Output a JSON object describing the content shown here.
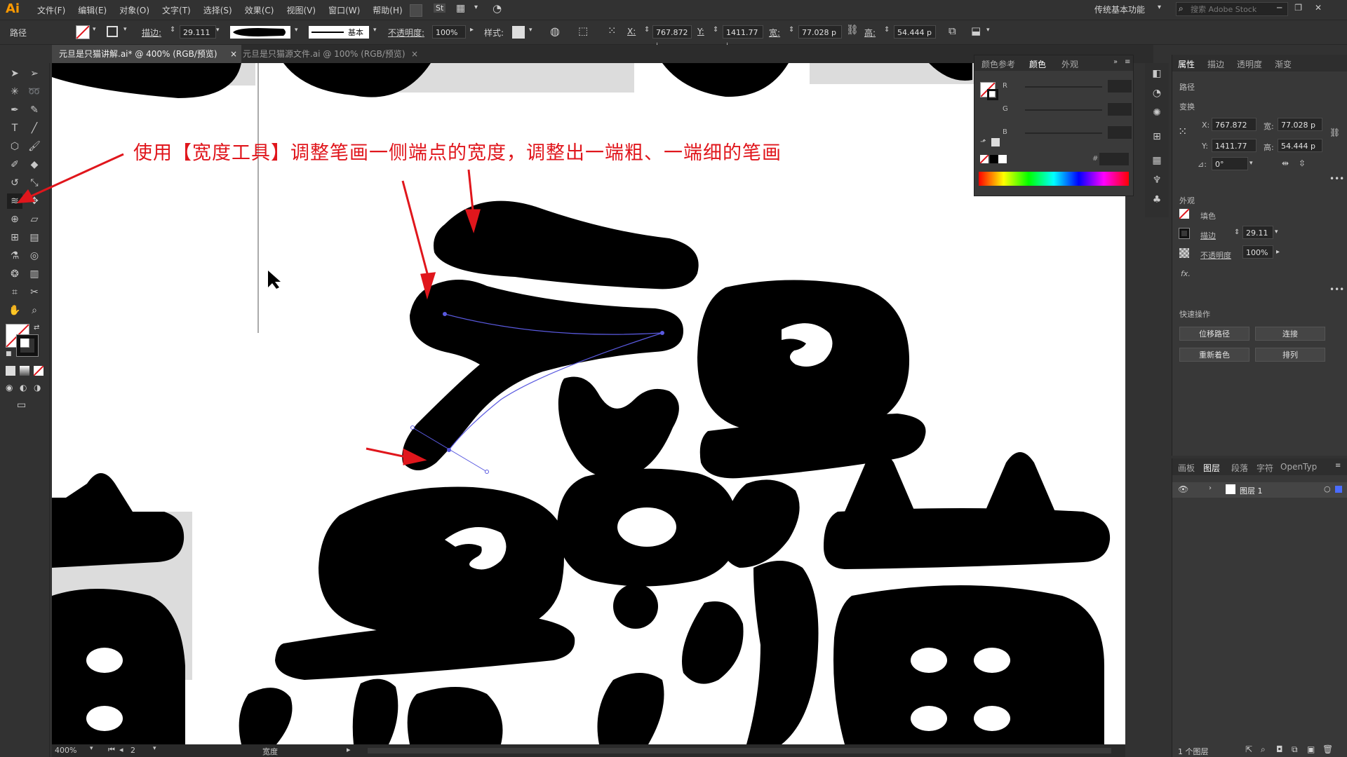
{
  "app": {
    "logo": "Ai",
    "workspace": "传统基本功能",
    "stock_search_placeholder": "搜索 Adobe Stock"
  },
  "menu": [
    "文件(F)",
    "编辑(E)",
    "对象(O)",
    "文字(T)",
    "选择(S)",
    "效果(C)",
    "视图(V)",
    "窗口(W)",
    "帮助(H)"
  ],
  "menu_extra": {
    "st": "St"
  },
  "control": {
    "object_type": "路径",
    "stroke_label": "描边:",
    "stroke_value": "29.111",
    "brush_label": "基本",
    "opacity_label": "不透明度:",
    "opacity_value": "100%",
    "style_label": "样式:",
    "x_label": "X:",
    "x_value": "767.872 i",
    "y_label": "Y:",
    "y_value": "1411.77 i",
    "w_label": "宽:",
    "w_value": "77.028 p",
    "h_label": "高:",
    "h_value": "54.444 p"
  },
  "tabs": [
    {
      "label": "元旦是只猫讲解.ai* @ 400% (RGB/预览)",
      "close": "×"
    },
    {
      "label": "元旦是只猫源文件.ai @ 100% (RGB/预览)",
      "close": "×"
    }
  ],
  "annotation": "使用【宽度工具】调整笔画一侧端点的宽度，调整出一端粗、一端细的笔画",
  "status": {
    "zoom": "400%",
    "page": "2",
    "tool": "宽度"
  },
  "color_panel": {
    "tabs": [
      "颜色参考",
      "颜色",
      "外观"
    ],
    "channels": [
      "R",
      "G",
      "B"
    ],
    "hex_label": "#"
  },
  "properties": {
    "tabs": [
      "属性",
      "描边",
      "透明度",
      "渐变"
    ],
    "section_path": "路径",
    "section_transform": "变换",
    "x_label": "X:",
    "x_value": "767.872",
    "y_label": "Y:",
    "y_value": "1411.77",
    "w_label": "宽:",
    "w_value": "77.028 p",
    "h_label": "高:",
    "h_value": "54.444 p",
    "angle_label": "⊿:",
    "angle_value": "0°",
    "section_appearance": "外观",
    "fill_label": "填色",
    "stroke_label": "描边",
    "stroke_value": "29.11",
    "opacity_label": "不透明度",
    "opacity_value": "100%",
    "fx_label": "fx.",
    "section_quick": "快速操作",
    "btn_offset": "位移路径",
    "btn_join": "连接",
    "btn_recolor": "重新着色",
    "btn_arrange": "排列"
  },
  "layers": {
    "tabs": [
      "画板",
      "图层",
      "段落",
      "字符",
      "OpenTyp"
    ],
    "layer_name": "图层 1",
    "footer": "1 个图层"
  },
  "colors": {
    "accent_red": "#e0161c",
    "path_blue": "#5a5ae0",
    "artboard": "#ffffff"
  }
}
